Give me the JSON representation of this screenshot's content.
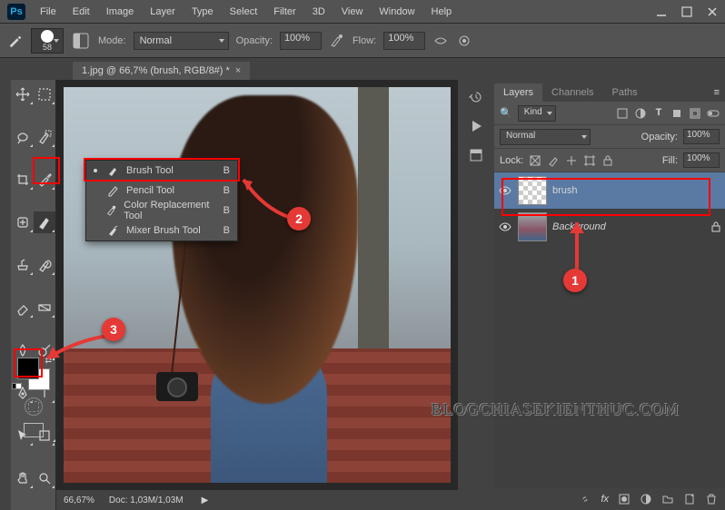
{
  "menubar": {
    "logo": "Ps",
    "items": [
      "File",
      "Edit",
      "Image",
      "Layer",
      "Type",
      "Select",
      "Filter",
      "3D",
      "View",
      "Window",
      "Help"
    ]
  },
  "options": {
    "brush_size": "58",
    "mode_label": "Mode:",
    "mode_value": "Normal",
    "opacity_label": "Opacity:",
    "opacity_value": "100%",
    "flow_label": "Flow:",
    "flow_value": "100%"
  },
  "doc_tab": {
    "title": "1.jpg @ 66,7% (brush, RGB/8#)  *"
  },
  "brush_flyout": {
    "items": [
      {
        "label": "Brush Tool",
        "shortcut": "B",
        "icon": "brush",
        "selected": true
      },
      {
        "label": "Pencil Tool",
        "shortcut": "B",
        "icon": "pencil",
        "selected": false
      },
      {
        "label": "Color Replacement Tool",
        "shortcut": "B",
        "icon": "color-replace",
        "selected": false
      },
      {
        "label": "Mixer Brush Tool",
        "shortcut": "B",
        "icon": "mixer-brush",
        "selected": false
      }
    ]
  },
  "layers_panel": {
    "tabs": [
      "Layers",
      "Channels",
      "Paths"
    ],
    "active_tab": 0,
    "filter_label": "Kind",
    "blend_label": "Normal",
    "opacity_label": "Opacity:",
    "opacity_value": "100%",
    "lock_label": "Lock:",
    "fill_label": "Fill:",
    "fill_value": "100%",
    "layers": [
      {
        "name": "brush",
        "thumb": "checker",
        "locked": false,
        "selected": true
      },
      {
        "name": "Background",
        "thumb": "photo",
        "locked": true,
        "selected": false
      }
    ]
  },
  "status": {
    "zoom": "66,67%",
    "doc": "Doc:  1,03M/1,03M"
  },
  "annotations": {
    "n1": "1",
    "n2": "2",
    "n3": "3"
  },
  "watermark": "BLOGCHIASEKIENTHUC.COM",
  "foreground_color": "#000000",
  "background_color": "#ffffff"
}
